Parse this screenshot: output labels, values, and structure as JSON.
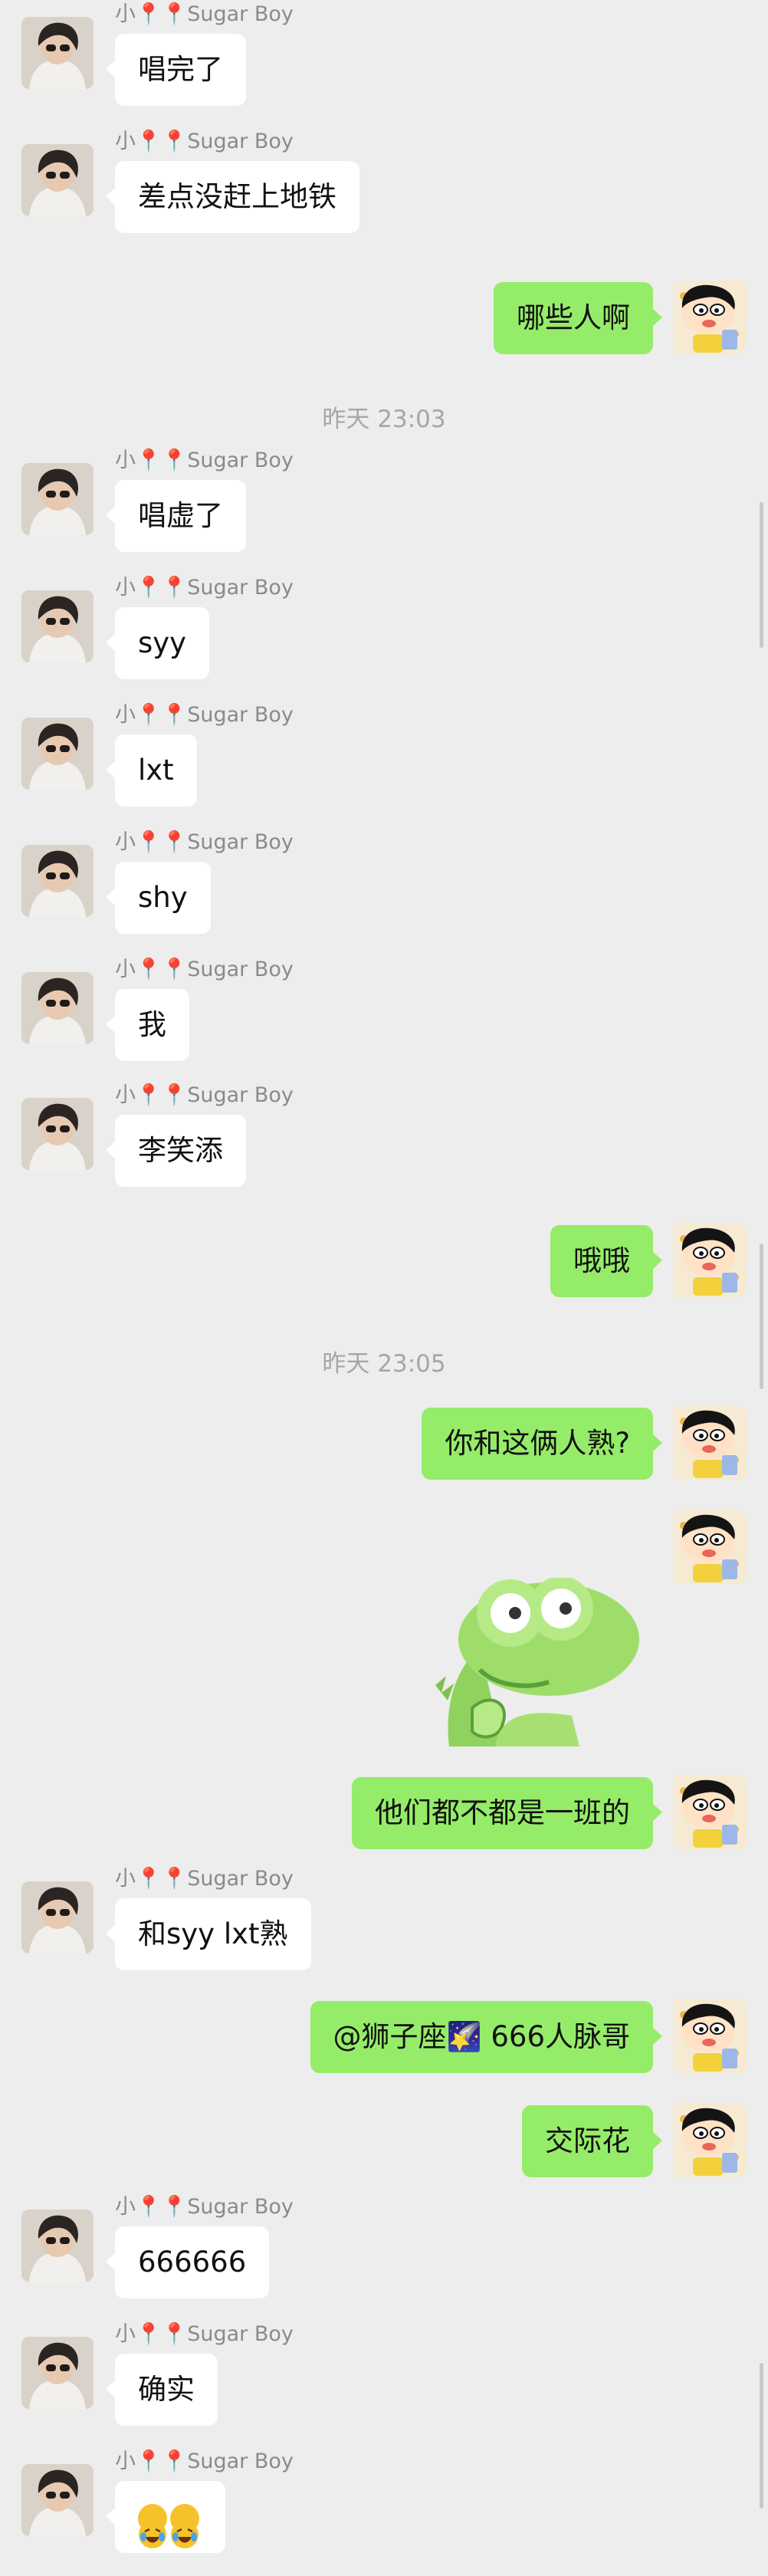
{
  "colors": {
    "background": "#ededed",
    "incoming_bubble": "#ffffff",
    "outgoing_bubble": "#95ec69",
    "timestamp_text": "#a6a6a6",
    "name_text": "#8a8a8a"
  },
  "sender_name": "小📍📍Sugar Boy",
  "messages": [
    {
      "type": "in",
      "text": "唱完了"
    },
    {
      "type": "in",
      "text": "差点没赶上地铁"
    },
    {
      "type": "out",
      "text": "哪些人啊"
    },
    {
      "type": "time",
      "text": "昨天 23:03"
    },
    {
      "type": "in",
      "text": "唱虚了"
    },
    {
      "type": "in",
      "text": "syy"
    },
    {
      "type": "in",
      "text": "lxt"
    },
    {
      "type": "in",
      "text": "shy"
    },
    {
      "type": "in",
      "text": "我"
    },
    {
      "type": "in",
      "text": "李笑添"
    },
    {
      "type": "out",
      "text": "哦哦"
    },
    {
      "type": "time",
      "text": "昨天 23:05"
    },
    {
      "type": "out",
      "text": "你和这俩人熟?"
    },
    {
      "type": "out_sticker",
      "sticker": "green-crocodile-sticker"
    },
    {
      "type": "out",
      "text": "他们都不都是一班的"
    },
    {
      "type": "in",
      "text": "和syy lxt熟"
    },
    {
      "type": "out",
      "text": "@狮子座🌠 666人脉哥"
    },
    {
      "type": "out",
      "text": "交际花"
    },
    {
      "type": "in",
      "text": "666666"
    },
    {
      "type": "in",
      "text": "确实"
    },
    {
      "type": "in_emoji",
      "emoji": [
        "laughing-crying-emoji",
        "laughing-crying-emoji"
      ]
    }
  ]
}
